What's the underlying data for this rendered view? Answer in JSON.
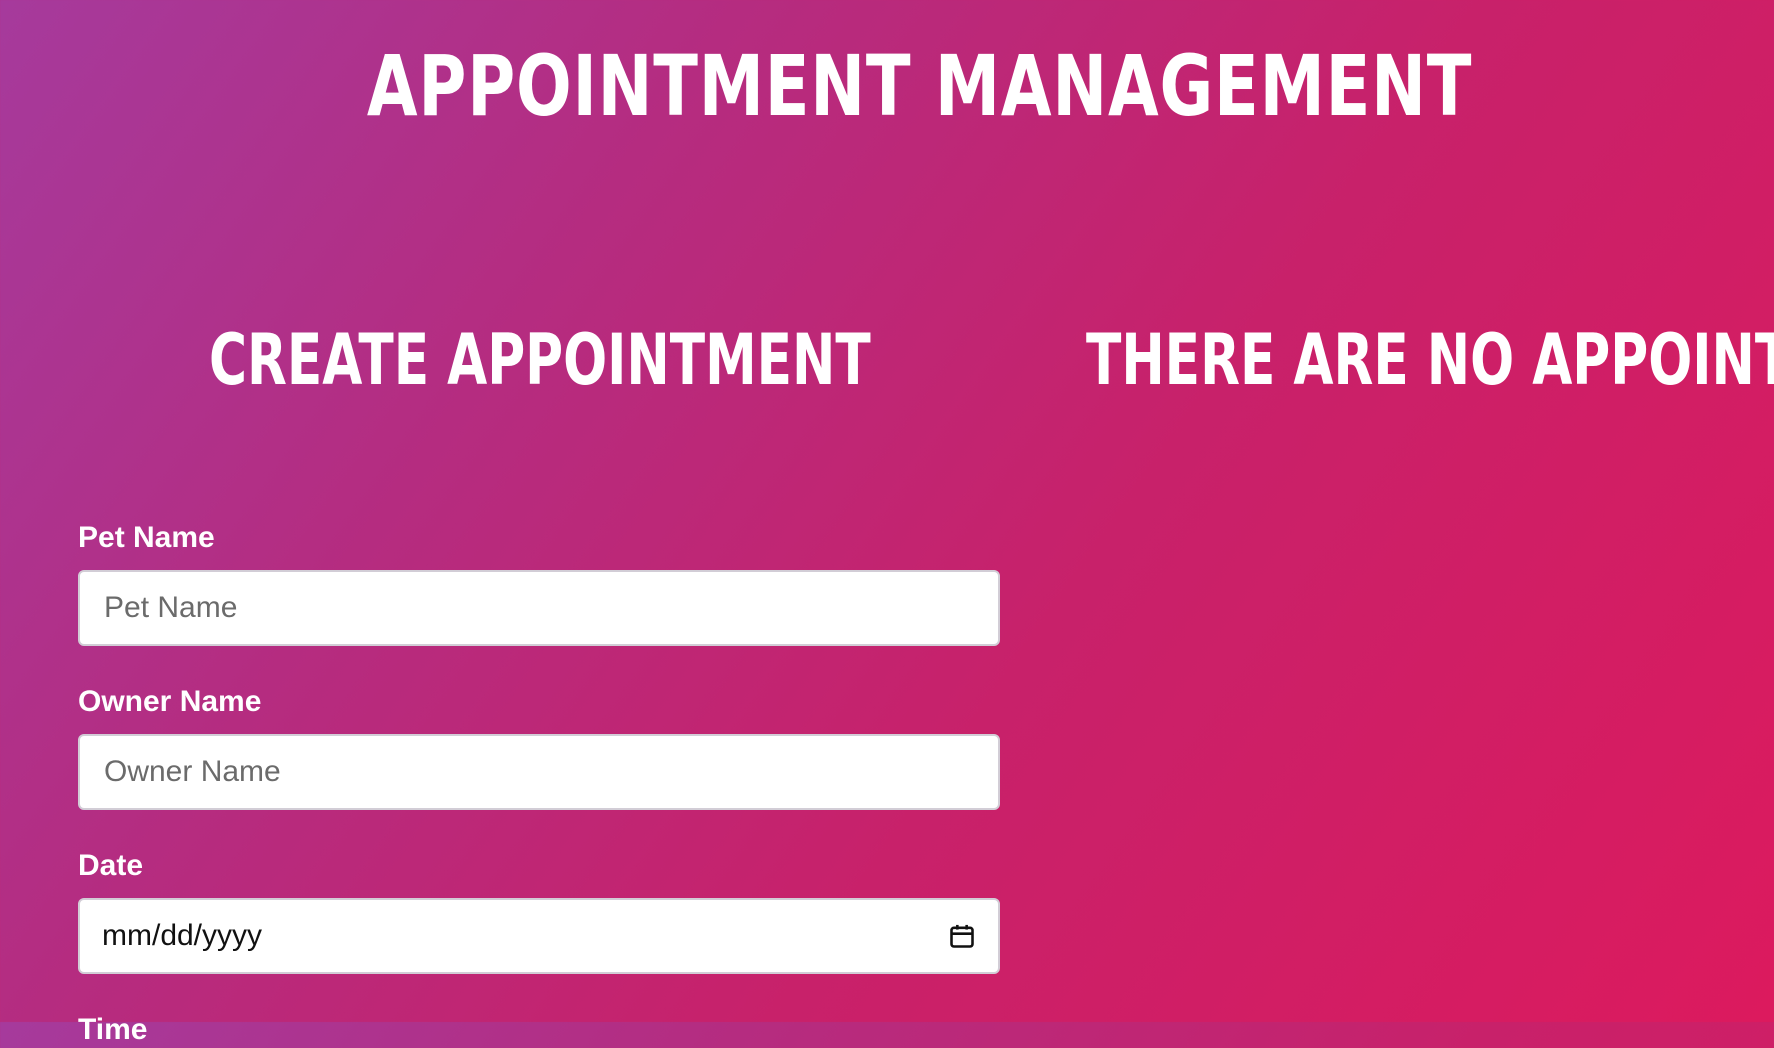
{
  "header": {
    "title": "APPOINTMENT MANAGEMENT"
  },
  "create_section": {
    "title": "CREATE APPOINTMENT",
    "fields": {
      "pet_name": {
        "label": "Pet Name",
        "placeholder": "Pet Name",
        "value": ""
      },
      "owner_name": {
        "label": "Owner Name",
        "placeholder": "Owner Name",
        "value": ""
      },
      "date": {
        "label": "Date",
        "display_value": "mm/dd/yyyy",
        "icon": "calendar-icon"
      },
      "time": {
        "label": "Time"
      }
    }
  },
  "list_section": {
    "empty_message": "THERE ARE NO APPOINT"
  },
  "theme": {
    "gradient_start": "#a63a9c",
    "gradient_end": "#dc1a5e",
    "text_color": "#ffffff"
  }
}
